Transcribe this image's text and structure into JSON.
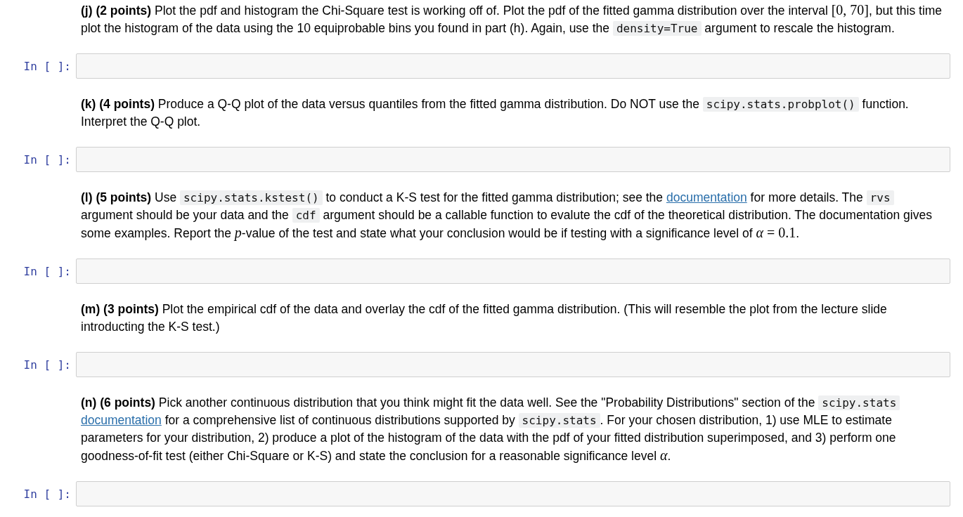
{
  "cells": [
    {
      "kind": "markdown",
      "segments": [
        {
          "kind": "text",
          "text": "**(j) (2 points)** Plot the pdf and histogram the Chi-Square test is working off of. Plot the pdf of the fitted gamma distribution over the interval "
        },
        {
          "kind": "math",
          "text": "[0, 70]"
        },
        {
          "kind": "text",
          "text": ", but this time plot the histogram of the data using the 10 equiprobable bins you found in part (h). Again, use the "
        },
        {
          "kind": "code",
          "text": "density=True"
        },
        {
          "kind": "text",
          "text": " argument to rescale the histogram."
        }
      ]
    },
    {
      "kind": "code",
      "prompt": "In [ ]:"
    },
    {
      "kind": "markdown",
      "segments": [
        {
          "kind": "text",
          "text": "**(k) (4 points)** Produce a Q-Q plot of the data versus quantiles from the fitted gamma distribution. Do NOT use the "
        },
        {
          "kind": "code",
          "text": "scipy.stats.probplot()"
        },
        {
          "kind": "text",
          "text": " function. Interpret the Q-Q plot."
        }
      ]
    },
    {
      "kind": "code",
      "prompt": "In [ ]:"
    },
    {
      "kind": "markdown",
      "segments": [
        {
          "kind": "text",
          "text": "**(l) (5 points)** Use "
        },
        {
          "kind": "code",
          "text": "scipy.stats.kstest()"
        },
        {
          "kind": "text",
          "text": " to conduct a K-S test for the fitted gamma distribution; see the "
        },
        {
          "kind": "link",
          "text": "documentation"
        },
        {
          "kind": "text",
          "text": " for more details. The "
        },
        {
          "kind": "code",
          "text": "rvs"
        },
        {
          "kind": "text",
          "text": " argument should be your data and the "
        },
        {
          "kind": "code",
          "text": "cdf"
        },
        {
          "kind": "text",
          "text": " argument should be a callable function to evalute the cdf of the theoretical distribution. The documentation gives some examples. Report the "
        },
        {
          "kind": "math",
          "text": "*p*"
        },
        {
          "kind": "text",
          "text": "-value of the test and state what your conclusion would be if testing with a significance level of "
        },
        {
          "kind": "math",
          "text": "*α* = 0.1"
        },
        {
          "kind": "text",
          "text": "."
        }
      ]
    },
    {
      "kind": "code",
      "prompt": "In [ ]:"
    },
    {
      "kind": "markdown",
      "segments": [
        {
          "kind": "text",
          "text": "**(m) (3 points)** Plot the empirical cdf of the data and overlay the cdf of the fitted gamma distribution. (This will resemble the plot from the lecture slide introducting the K-S test.)"
        }
      ]
    },
    {
      "kind": "code",
      "prompt": "In [ ]:"
    },
    {
      "kind": "markdown",
      "segments": [
        {
          "kind": "text",
          "text": "**(n) (6 points)** Pick another continuous distribution that you think might fit the data well. See the \"Probability Distributions\" section of the "
        },
        {
          "kind": "code",
          "text": "scipy.stats "
        },
        {
          "kind": "link",
          "text": "documentation"
        },
        {
          "kind": "text",
          "text": " for a comprehensive list of continuous distributions supported by "
        },
        {
          "kind": "code",
          "text": "scipy.stats"
        },
        {
          "kind": "text",
          "text": ". For your chosen distribution, 1) use MLE to estimate parameters for your distribution, 2) produce a plot of the histogram of the data with the pdf of your fitted distribution superimposed, and 3) perform one goodness-of-fit test (either Chi-Square or K-S) and state the conclusion for a reasonable significance level "
        },
        {
          "kind": "math",
          "text": "*α*"
        },
        {
          "kind": "text",
          "text": "."
        }
      ]
    },
    {
      "kind": "code",
      "prompt": "In [ ]:"
    }
  ]
}
